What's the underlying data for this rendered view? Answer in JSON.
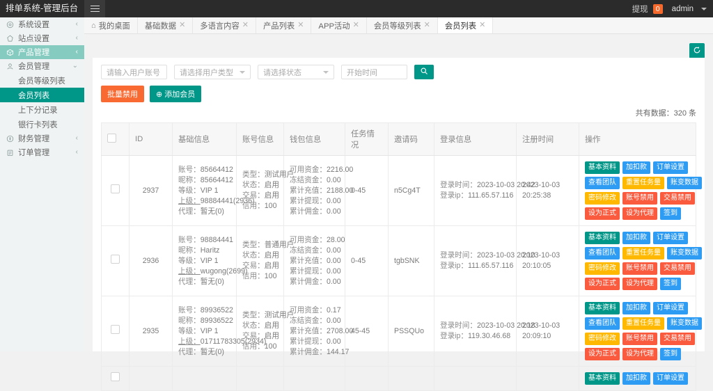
{
  "topbar": {
    "brand": "排单系统-管理后台",
    "menu_toggle_icon": "hamburger-icon",
    "withdraw_label": "提现",
    "withdraw_badge": "0",
    "admin_label": "admin"
  },
  "sidebar": {
    "groups": [
      {
        "label": "系统设置",
        "icon": "gear-icon",
        "arrow": "‹",
        "active": false
      },
      {
        "label": "站点设置",
        "icon": "globe-icon",
        "arrow": "‹",
        "active": false
      },
      {
        "label": "产品管理",
        "icon": "box-icon",
        "arrow": "‹",
        "active": true
      },
      {
        "label": "会员管理",
        "icon": "user-icon",
        "arrow": "⌄",
        "active": false
      }
    ],
    "sub_items": [
      {
        "label": "会员等级列表",
        "active": false
      },
      {
        "label": "会员列表",
        "active": true
      },
      {
        "label": "上下分记录",
        "active": false
      },
      {
        "label": "银行卡列表",
        "active": false
      }
    ],
    "groups_bottom": [
      {
        "label": "财务管理",
        "icon": "coin-icon",
        "arrow": "‹"
      },
      {
        "label": "订单管理",
        "icon": "clipboard-icon",
        "arrow": "‹"
      }
    ]
  },
  "tabs": [
    {
      "label": "我的桌面",
      "icon": "home-icon",
      "closable": false,
      "active": false
    },
    {
      "label": "基础数据",
      "closable": true,
      "active": false
    },
    {
      "label": "多语言内容",
      "closable": true,
      "active": false
    },
    {
      "label": "产品列表",
      "closable": true,
      "active": false
    },
    {
      "label": "APP活动",
      "closable": true,
      "active": false
    },
    {
      "label": "会员等级列表",
      "closable": true,
      "active": false
    },
    {
      "label": "会员列表",
      "closable": true,
      "active": true
    }
  ],
  "toolbar": {
    "refresh_icon": "refresh-icon",
    "search_icon": "search-icon",
    "account_placeholder": "请输入用户账号",
    "usertype_placeholder": "请选择用户类型",
    "status_placeholder": "请选择状态",
    "starttime_placeholder": "开始时间",
    "bulk_disable_label": "批量禁用",
    "add_member_label": "添加会员",
    "total_text": "共有数据：320 条"
  },
  "table": {
    "headers": [
      "",
      "ID",
      "基础信息",
      "账号信息",
      "钱包信息",
      "任务情况",
      "邀请码",
      "登录信息",
      "注册时间",
      "操作"
    ],
    "labels": {
      "account": "账号：",
      "nickname": "昵称：",
      "level": "等级：",
      "parent": "上级：",
      "agent": "代理：",
      "type": "类型：",
      "status": "状态：",
      "trade": "交易：",
      "credit": "信用：",
      "available": "可用资金：",
      "frozen": "冻结资金：",
      "recharge": "累计充值：",
      "withdraw": "累计提现：",
      "commission": "累计佣金：",
      "login_time": "登录时间：",
      "login_ip": "登录ip："
    },
    "action_buttons": [
      [
        {
          "label": "基本资料",
          "color": "green"
        },
        {
          "label": "加扣款",
          "color": "blue"
        },
        {
          "label": "订单设置",
          "color": "blue"
        }
      ],
      [
        {
          "label": "查看团队",
          "color": "blue"
        },
        {
          "label": "重置任务量",
          "color": "yellow"
        },
        {
          "label": "账变数据",
          "color": "blue"
        }
      ],
      [
        {
          "label": "密码修改",
          "color": "yellow"
        },
        {
          "label": "账号禁用",
          "color": "red"
        },
        {
          "label": "交易禁用",
          "color": "red"
        }
      ],
      [
        {
          "label": "设为正式",
          "color": "red"
        },
        {
          "label": "设为代理",
          "color": "red"
        },
        {
          "label": "签到",
          "color": "blue"
        }
      ]
    ],
    "rows": [
      {
        "id": "2937",
        "account": "85664412",
        "nickname": "85664412",
        "level": "VIP 1",
        "parent": "98884441(2936)",
        "agent": "暂无(0)",
        "type": "测试用户",
        "status": "启用",
        "trade": "启用",
        "credit": "100",
        "available": "2216.00",
        "frozen": "0.00",
        "recharge": "2188.00",
        "withdraw": "0.00",
        "commission": "0.00",
        "task": "0-45",
        "invite_code": "n5Cg4T",
        "login_time": "2023-10-03 20:42",
        "login_ip": "111.65.57.116",
        "register_time": "2023-10-03 20:25:38"
      },
      {
        "id": "2936",
        "account": "98884441",
        "nickname": "Haritz",
        "level": "VIP 1",
        "parent": "wugong(2699)",
        "agent": "暂无(0)",
        "type": "普通用户",
        "status": "启用",
        "trade": "启用",
        "credit": "100",
        "available": "28.00",
        "frozen": "0.00",
        "recharge": "0.00",
        "withdraw": "0.00",
        "commission": "0.00",
        "task": "0-45",
        "invite_code": "tgbSNK",
        "login_time": "2023-10-03 20:10",
        "login_ip": "111.65.57.116",
        "register_time": "2023-10-03 20:10:05"
      },
      {
        "id": "2935",
        "account": "89936522",
        "nickname": "89936522",
        "level": "VIP 1",
        "parent": "01711783305(2934)",
        "agent": "暂无(0)",
        "type": "测试用户",
        "status": "启用",
        "trade": "启用",
        "credit": "100",
        "available": "0.17",
        "frozen": "0.00",
        "recharge": "2708.00",
        "withdraw": "0.00",
        "commission": "144.17",
        "task": "45-45",
        "invite_code": "PSSQUo",
        "login_time": "2023-10-03 20:18",
        "login_ip": "119.30.46.68",
        "register_time": "2023-10-03 20:09:10"
      }
    ]
  },
  "colors": {
    "accent": "#009688",
    "orange": "#f96a33",
    "blue": "#2f9cf4",
    "yellow": "#ffb800",
    "red": "#fa5a3d",
    "sidebar_active": "#86cbc0"
  }
}
